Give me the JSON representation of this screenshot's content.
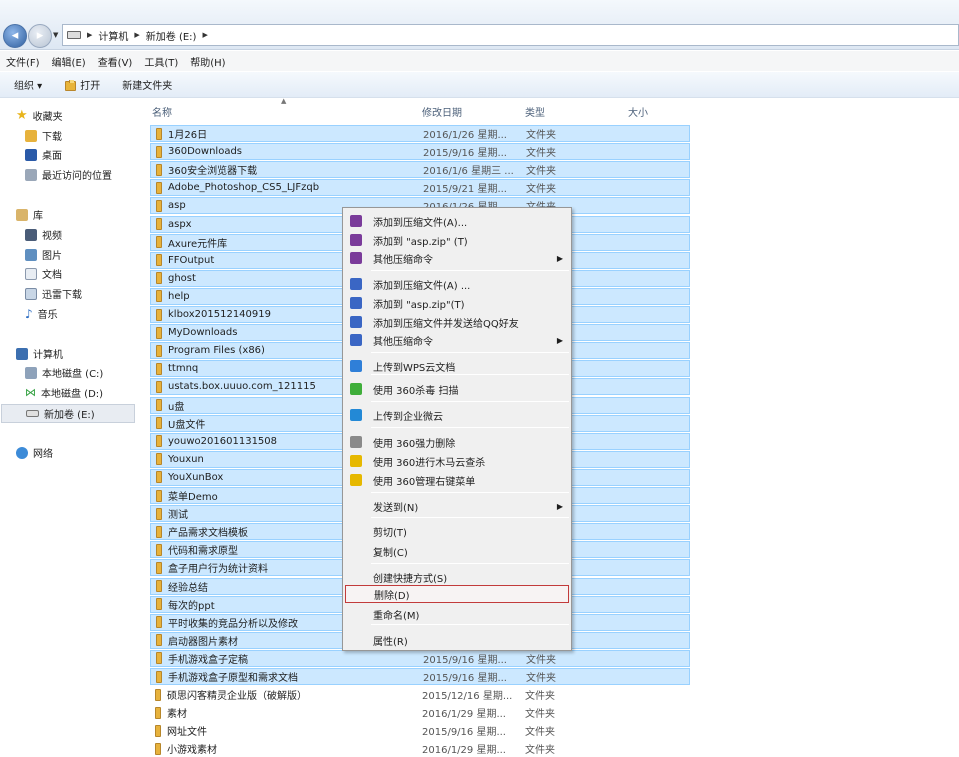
{
  "address": {
    "crumbs": [
      "计算机",
      "新加卷 (E:)"
    ]
  },
  "menu": [
    "文件(F)",
    "编辑(E)",
    "查看(V)",
    "工具(T)",
    "帮助(H)"
  ],
  "toolbar": {
    "organize": "组织 ▾",
    "open": "打开",
    "new_folder": "新建文件夹"
  },
  "sidebar": {
    "favorites": "收藏夹",
    "fav_items": [
      "下载",
      "桌面",
      "最近访问的位置"
    ],
    "libraries": "库",
    "lib_items": [
      "视频",
      "图片",
      "文档",
      "迅雷下载",
      "音乐"
    ],
    "computer": "计算机",
    "drives": [
      "本地磁盘 (C:)",
      "本地磁盘 (D:)",
      "新加卷 (E:)"
    ],
    "network": "网络"
  },
  "columns": {
    "name": "名称",
    "date": "修改日期",
    "type": "类型",
    "size": "大小"
  },
  "files": [
    {
      "name": "1月26日",
      "date": "2016/1/26 星期...",
      "type": "文件夹",
      "sel": true
    },
    {
      "name": "360Downloads",
      "date": "2015/9/16 星期...",
      "type": "文件夹",
      "sel": true
    },
    {
      "name": "360安全浏览器下载",
      "date": "2016/1/6 星期三 ...",
      "type": "文件夹",
      "sel": true
    },
    {
      "name": "Adobe_Photoshop_CS5_LJFzqb",
      "date": "2015/9/21 星期...",
      "type": "文件夹",
      "sel": true
    },
    {
      "name": "asp",
      "date": "2016/1/26 星期...",
      "type": "文件夹",
      "sel": true
    },
    {
      "name": "aspx",
      "date": "",
      "type": "",
      "sel": true
    },
    {
      "name": "Axure元件库",
      "date": "",
      "type": "",
      "sel": true
    },
    {
      "name": "FFOutput",
      "date": "",
      "type": "",
      "sel": true
    },
    {
      "name": "ghost",
      "date": "",
      "type": "",
      "sel": true
    },
    {
      "name": "help",
      "date": "",
      "type": "",
      "sel": true
    },
    {
      "name": "klbox201512140919",
      "date": "",
      "type": "",
      "sel": true
    },
    {
      "name": "MyDownloads",
      "date": "",
      "type": "",
      "sel": true
    },
    {
      "name": "Program Files (x86)",
      "date": "",
      "type": "",
      "sel": true
    },
    {
      "name": "ttmnq",
      "date": "",
      "type": "",
      "sel": true
    },
    {
      "name": "ustats.box.uuuo.com_121115",
      "date": "",
      "type": "",
      "sel": true
    },
    {
      "name": "u盘",
      "date": "",
      "type": "",
      "sel": true
    },
    {
      "name": "U盘文件",
      "date": "",
      "type": "",
      "sel": true
    },
    {
      "name": "youwo201601131508",
      "date": "",
      "type": "",
      "sel": true
    },
    {
      "name": "Youxun",
      "date": "",
      "type": "",
      "sel": true
    },
    {
      "name": "YouXunBox",
      "date": "",
      "type": "",
      "sel": true
    },
    {
      "name": "菜单Demo",
      "date": "",
      "type": "",
      "sel": true
    },
    {
      "name": "测试",
      "date": "",
      "type": "",
      "sel": true
    },
    {
      "name": "产品需求文档模板",
      "date": "",
      "type": "",
      "sel": true
    },
    {
      "name": "代码和需求原型",
      "date": "",
      "type": "",
      "sel": true
    },
    {
      "name": "盒子用户行为统计资料",
      "date": "",
      "type": "",
      "sel": true
    },
    {
      "name": "经验总结",
      "date": "",
      "type": "",
      "sel": true
    },
    {
      "name": "每次的ppt",
      "date": "",
      "type": "",
      "sel": true
    },
    {
      "name": "平时收集的竞品分析以及修改",
      "date": "",
      "type": "",
      "sel": true
    },
    {
      "name": "启动器图片素材",
      "date": "",
      "type": "",
      "sel": true
    },
    {
      "name": "手机游戏盒子定稿",
      "date": "2015/9/16 星期...",
      "type": "文件夹",
      "sel": true
    },
    {
      "name": "手机游戏盒子原型和需求文档",
      "date": "2015/9/16 星期...",
      "type": "文件夹",
      "sel": true
    },
    {
      "name": "硕思闪客精灵企业版（破解版）",
      "date": "2015/12/16 星期...",
      "type": "文件夹",
      "sel": false
    },
    {
      "name": "素材",
      "date": "2016/1/29 星期...",
      "type": "文件夹",
      "sel": false
    },
    {
      "name": "网址文件",
      "date": "2015/9/16 星期...",
      "type": "文件夹",
      "sel": false
    },
    {
      "name": "小游戏素材",
      "date": "2016/1/29 星期...",
      "type": "文件夹",
      "sel": false
    }
  ],
  "context_menu": [
    {
      "label": "添加到压缩文件(A)...",
      "icon": "winrar-icon",
      "color": "#7a3b9a"
    },
    {
      "label": "添加到 \"asp.zip\" (T)",
      "icon": "winrar-icon",
      "color": "#7a3b9a"
    },
    {
      "label": "其他压缩命令",
      "icon": "winrar-icon",
      "color": "#7a3b9a",
      "sub": true
    },
    {
      "label": "添加到压缩文件(A) ...",
      "icon": "zip-icon",
      "color": "#3a66c4"
    },
    {
      "label": "添加到 \"asp.zip\"(T)",
      "icon": "zip-icon",
      "color": "#3a66c4"
    },
    {
      "label": "添加到压缩文件并发送给QQ好友",
      "icon": "zip-icon",
      "color": "#3a66c4"
    },
    {
      "label": "其他压缩命令",
      "icon": "zip-icon",
      "color": "#3a66c4",
      "sub": true
    },
    {
      "label": "上传到WPS云文档",
      "icon": "wps-cloud-icon",
      "color": "#2f7fd8"
    },
    {
      "label": "使用 360杀毒 扫描",
      "icon": "shield-icon",
      "color": "#3fae3a"
    },
    {
      "label": "上传到企业微云",
      "icon": "cloud-icon",
      "color": "#2389d6"
    },
    {
      "label": "使用 360强力删除",
      "icon": "shredder-icon",
      "color": "#8a8a8a"
    },
    {
      "label": "使用 360进行木马云查杀",
      "icon": "360-icon",
      "color": "#e6b800"
    },
    {
      "label": "使用 360管理右键菜单",
      "icon": "360-icon",
      "color": "#e6b800"
    },
    {
      "label": "发送到(N)",
      "sub": true
    },
    {
      "label": "剪切(T)"
    },
    {
      "label": "复制(C)"
    },
    {
      "label": "创建快捷方式(S)"
    },
    {
      "label": "删除(D)",
      "highlight": true
    },
    {
      "label": "重命名(M)"
    },
    {
      "label": "属性(R)"
    }
  ]
}
